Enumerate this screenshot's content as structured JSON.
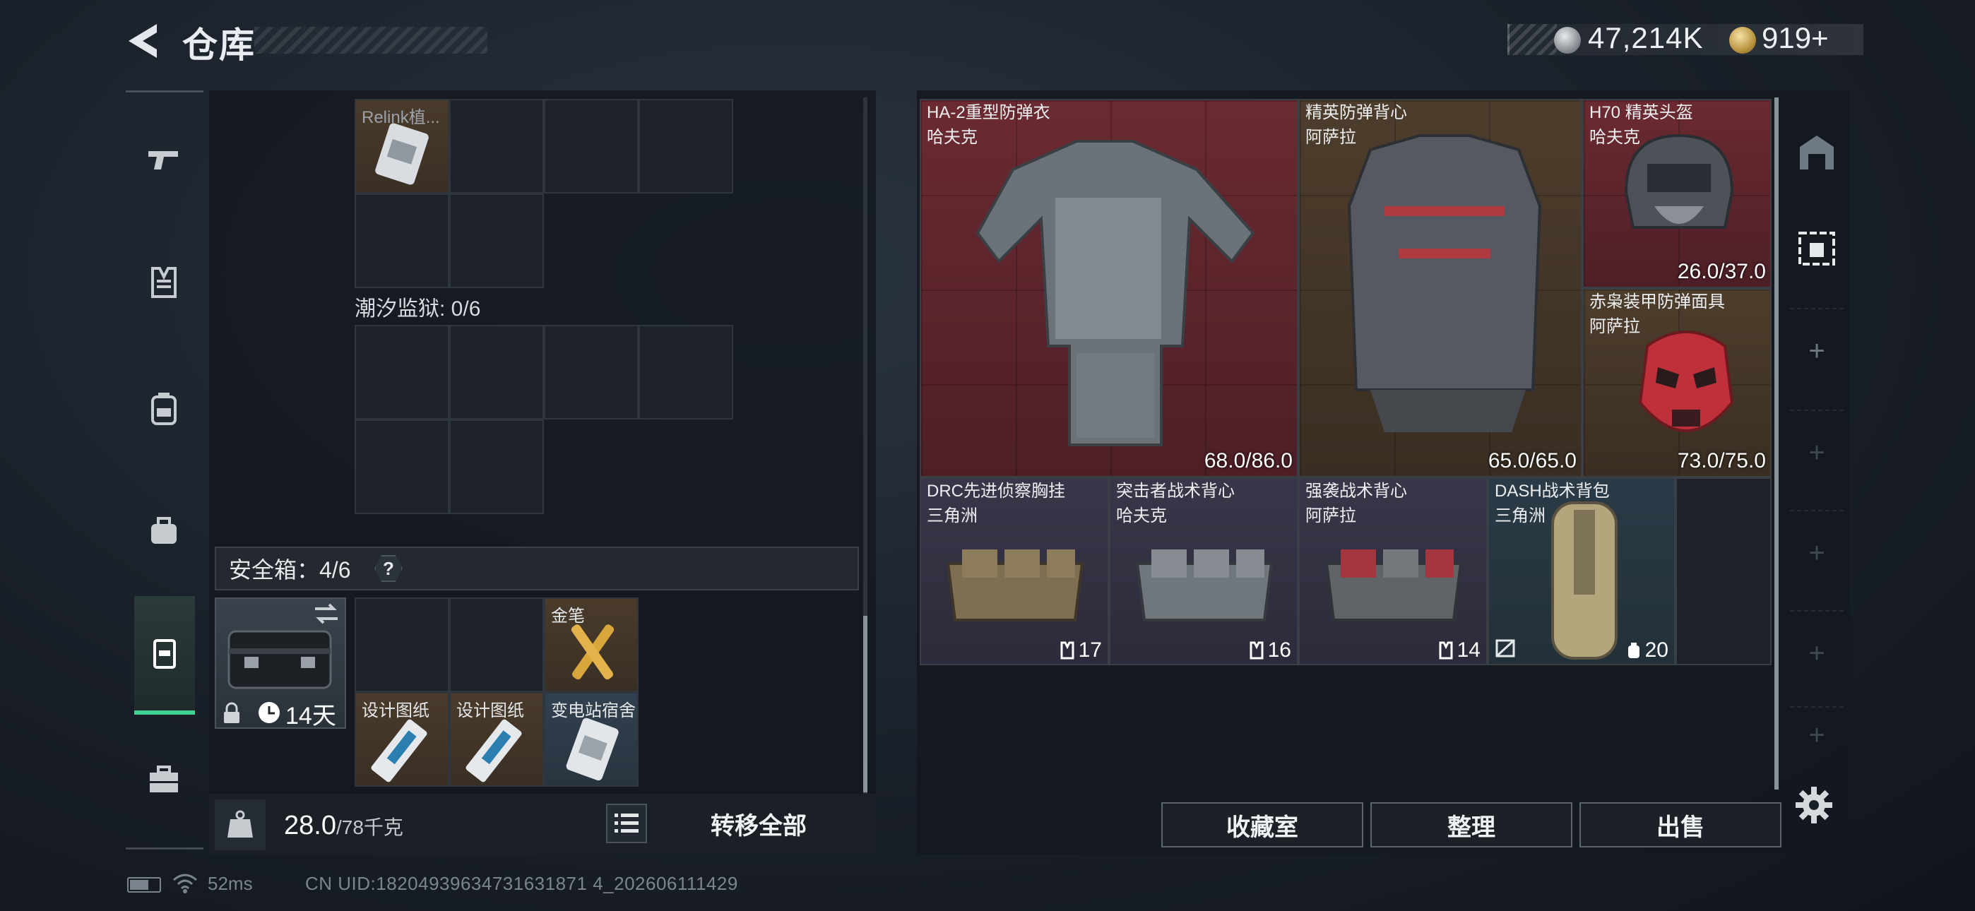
{
  "header": {
    "title": "仓库",
    "currency": {
      "silver_amount": "47,214K",
      "gold_amount": "919+"
    }
  },
  "left_rail": {
    "items": [
      {
        "name": "guns",
        "icon": "pistol-icon"
      },
      {
        "name": "armor",
        "icon": "vest-icon"
      },
      {
        "name": "backpack",
        "icon": "backpack-icon"
      },
      {
        "name": "bag",
        "icon": "bag-icon"
      },
      {
        "name": "safe-box",
        "icon": "safe-case-icon",
        "selected": true
      },
      {
        "name": "toolbox",
        "icon": "briefcase-icon"
      }
    ]
  },
  "storage": {
    "top_item_label": "Relink植...",
    "prison_label": "潮汐监狱: 0/6",
    "safebox_label": "安全箱：4/6",
    "safebox_help": "?",
    "case_days": "14天",
    "safe_items": [
      {
        "label": "金笔"
      },
      {
        "label": "设计图纸"
      },
      {
        "label": "设计图纸"
      },
      {
        "label": "变电站宿舍"
      }
    ]
  },
  "weight": {
    "current": "28.0",
    "max": "/78千克"
  },
  "transfer_all_label": "转移全部",
  "equipment": [
    {
      "name": "HA-2重型防弹衣",
      "maker": "哈夫克",
      "durability": "68.0/86.0",
      "color": "#5e2630"
    },
    {
      "name": "精英防弹背心",
      "maker": "阿萨拉",
      "durability": "65.0/65.0",
      "color": "#46382a"
    },
    {
      "name": "H70 精英头盔",
      "maker": "哈夫克",
      "durability": "26.0/37.0",
      "color": "#5e2630"
    },
    {
      "name": "赤枭装甲防弹面具",
      "maker": "阿萨拉",
      "durability": "73.0/75.0",
      "color": "#46382a"
    },
    {
      "name": "DRC先进侦察胸挂",
      "maker": "三角洲",
      "capacity": "17"
    },
    {
      "name": "突击者战术背心",
      "maker": "哈夫克",
      "capacity": "16"
    },
    {
      "name": "强袭战术背心",
      "maker": "阿萨拉",
      "capacity": "14"
    },
    {
      "name": "DASH战术背包",
      "maker": "三角洲",
      "capacity": "20"
    }
  ],
  "actions": {
    "collection": "收藏室",
    "organize": "整理",
    "sell": "出售"
  },
  "status": {
    "ping": "52ms",
    "uid": "CN UID:18204939634731631871 4_202606111429"
  }
}
